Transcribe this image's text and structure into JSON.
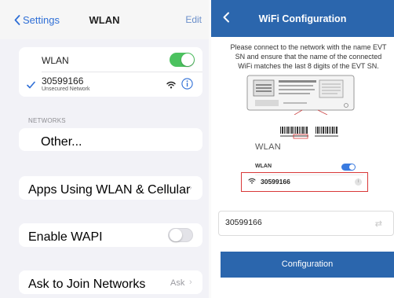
{
  "settings": {
    "nav": {
      "back_label": "Settings",
      "title": "WLAN",
      "edit_label": "Edit"
    },
    "wlan_row": {
      "label": "WLAN",
      "toggle_on": true
    },
    "connected_network": {
      "ssid": "30599166",
      "security": "Unsecured Network",
      "icons": [
        "checkmark-icon",
        "wifi-icon",
        "info-icon"
      ]
    },
    "networks_section": {
      "header": "NETWORKS",
      "other_label": "Other..."
    },
    "apps_row": {
      "label": "Apps Using WLAN & Cellular"
    },
    "wapi_row": {
      "label": "Enable WAPI",
      "toggle_on": false
    },
    "ask_row": {
      "label": "Ask to Join Networks",
      "value": "Ask"
    }
  },
  "app": {
    "header": {
      "title": "WiFi Configuration"
    },
    "instructions": [
      "Please connect to the network with the name EVT",
      "SN and ensure that the name of the connected",
      "WiFi matches the last 8 digits of the EVT SN."
    ],
    "example": {
      "wlan_heading": "WLAN",
      "wlan_row_label": "WLAN",
      "network_ssid": "30599166"
    },
    "ssid_input": {
      "value": "30599166"
    },
    "configure_button": {
      "label": "Configuration"
    }
  },
  "colors": {
    "ios_blue": "#2f6fd6",
    "toggle_green": "#4cc25f",
    "app_blue": "#2b66ad",
    "highlight_red": "#d93838"
  }
}
